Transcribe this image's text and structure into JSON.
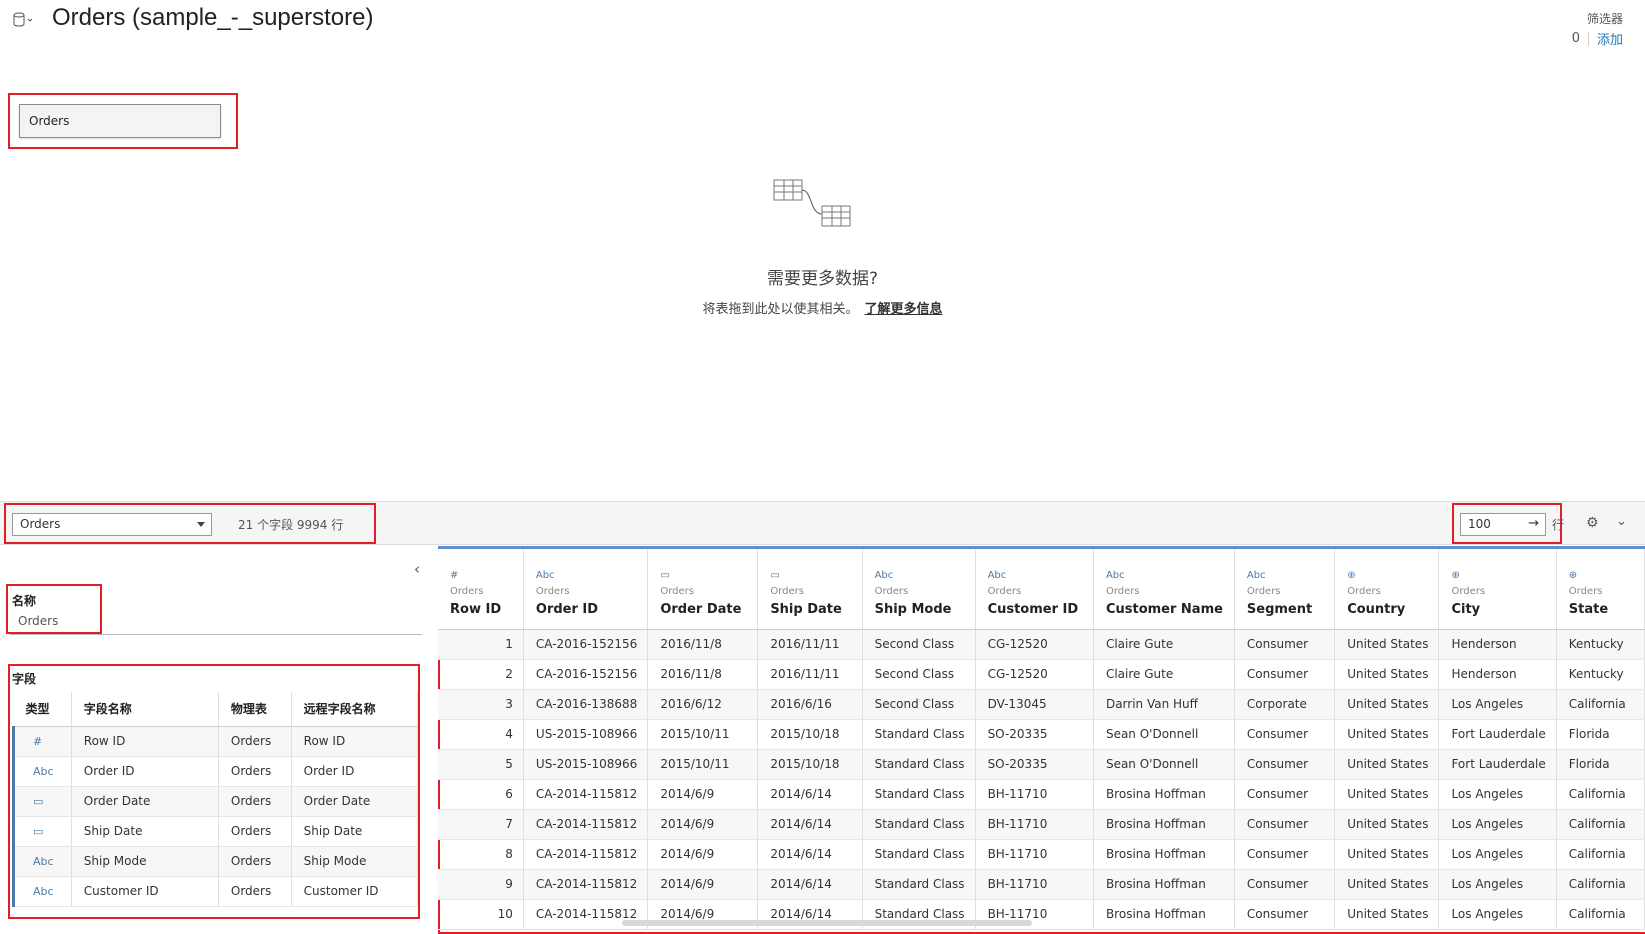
{
  "header": {
    "datasource_icon": "cylinder-database-icon",
    "title": "Orders (sample_-_superstore)",
    "filters": {
      "label": "筛选器",
      "count": "0",
      "add_label": "添加"
    }
  },
  "canvas": {
    "table_pill": "Orders",
    "illustration_icon": "join-tables-icon",
    "need_more": "需要更多数据?",
    "drag_hint": "将表拖到此处以使其相关。",
    "learn_more": "了解更多信息"
  },
  "toolbar": {
    "table_select": "Orders",
    "summary": "21 个字段 9994 行",
    "rows_value": "100",
    "rows_unit": "行",
    "go_icon": "arrow-right-icon",
    "settings_icon": "gear-icon",
    "expand_icon": "chevron-down-icon"
  },
  "metadata": {
    "collapse_icon": "chevron-left-icon",
    "name_heading": "名称",
    "name_value": "Orders",
    "fields_heading": "字段",
    "columns": [
      "类型",
      "字段名称",
      "物理表",
      "远程字段名称"
    ],
    "fields": [
      {
        "type": "#",
        "name": "Row ID",
        "table": "Orders",
        "remote": "Row ID"
      },
      {
        "type": "Abc",
        "name": "Order ID",
        "table": "Orders",
        "remote": "Order ID"
      },
      {
        "type": "▭",
        "name": "Order Date",
        "table": "Orders",
        "remote": "Order Date"
      },
      {
        "type": "▭",
        "name": "Ship Date",
        "table": "Orders",
        "remote": "Ship Date"
      },
      {
        "type": "Abc",
        "name": "Ship Mode",
        "table": "Orders",
        "remote": "Ship Mode"
      },
      {
        "type": "Abc",
        "name": "Customer ID",
        "table": "Orders",
        "remote": "Customer ID"
      }
    ]
  },
  "grid": {
    "columns": [
      {
        "icon": "#",
        "source": "Orders",
        "name": "Row ID"
      },
      {
        "icon": "Abc",
        "source": "Orders",
        "name": "Order ID"
      },
      {
        "icon": "▭",
        "source": "Orders",
        "name": "Order Date"
      },
      {
        "icon": "▭",
        "source": "Orders",
        "name": "Ship Date"
      },
      {
        "icon": "Abc",
        "source": "Orders",
        "name": "Ship Mode"
      },
      {
        "icon": "Abc",
        "source": "Orders",
        "name": "Customer ID"
      },
      {
        "icon": "Abc",
        "source": "Orders",
        "name": "Customer Name"
      },
      {
        "icon": "Abc",
        "source": "Orders",
        "name": "Segment"
      },
      {
        "icon": "⊕",
        "source": "Orders",
        "name": "Country"
      },
      {
        "icon": "⊕",
        "source": "Orders",
        "name": "City"
      },
      {
        "icon": "⊕",
        "source": "Orders",
        "name": "State"
      }
    ],
    "rows": [
      [
        "1",
        "CA-2016-152156",
        "2016/11/8",
        "2016/11/11",
        "Second Class",
        "CG-12520",
        "Claire Gute",
        "Consumer",
        "United States",
        "Henderson",
        "Kentucky"
      ],
      [
        "2",
        "CA-2016-152156",
        "2016/11/8",
        "2016/11/11",
        "Second Class",
        "CG-12520",
        "Claire Gute",
        "Consumer",
        "United States",
        "Henderson",
        "Kentucky"
      ],
      [
        "3",
        "CA-2016-138688",
        "2016/6/12",
        "2016/6/16",
        "Second Class",
        "DV-13045",
        "Darrin Van Huff",
        "Corporate",
        "United States",
        "Los Angeles",
        "California"
      ],
      [
        "4",
        "US-2015-108966",
        "2015/10/11",
        "2015/10/18",
        "Standard Class",
        "SO-20335",
        "Sean O'Donnell",
        "Consumer",
        "United States",
        "Fort Lauderdale",
        "Florida"
      ],
      [
        "5",
        "US-2015-108966",
        "2015/10/11",
        "2015/10/18",
        "Standard Class",
        "SO-20335",
        "Sean O'Donnell",
        "Consumer",
        "United States",
        "Fort Lauderdale",
        "Florida"
      ],
      [
        "6",
        "CA-2014-115812",
        "2014/6/9",
        "2014/6/14",
        "Standard Class",
        "BH-11710",
        "Brosina Hoffman",
        "Consumer",
        "United States",
        "Los Angeles",
        "California"
      ],
      [
        "7",
        "CA-2014-115812",
        "2014/6/9",
        "2014/6/14",
        "Standard Class",
        "BH-11710",
        "Brosina Hoffman",
        "Consumer",
        "United States",
        "Los Angeles",
        "California"
      ],
      [
        "8",
        "CA-2014-115812",
        "2014/6/9",
        "2014/6/14",
        "Standard Class",
        "BH-11710",
        "Brosina Hoffman",
        "Consumer",
        "United States",
        "Los Angeles",
        "California"
      ],
      [
        "9",
        "CA-2014-115812",
        "2014/6/9",
        "2014/6/14",
        "Standard Class",
        "BH-11710",
        "Brosina Hoffman",
        "Consumer",
        "United States",
        "Los Angeles",
        "California"
      ],
      [
        "10",
        "CA-2014-115812",
        "2014/6/9",
        "2014/6/14",
        "Standard Class",
        "BH-11710",
        "Brosina Hoffman",
        "Consumer",
        "United States",
        "Los Angeles",
        "California"
      ]
    ]
  },
  "colors": {
    "highlight": "#e41e26",
    "accent": "#4e79a7",
    "link": "#1f77b4"
  }
}
